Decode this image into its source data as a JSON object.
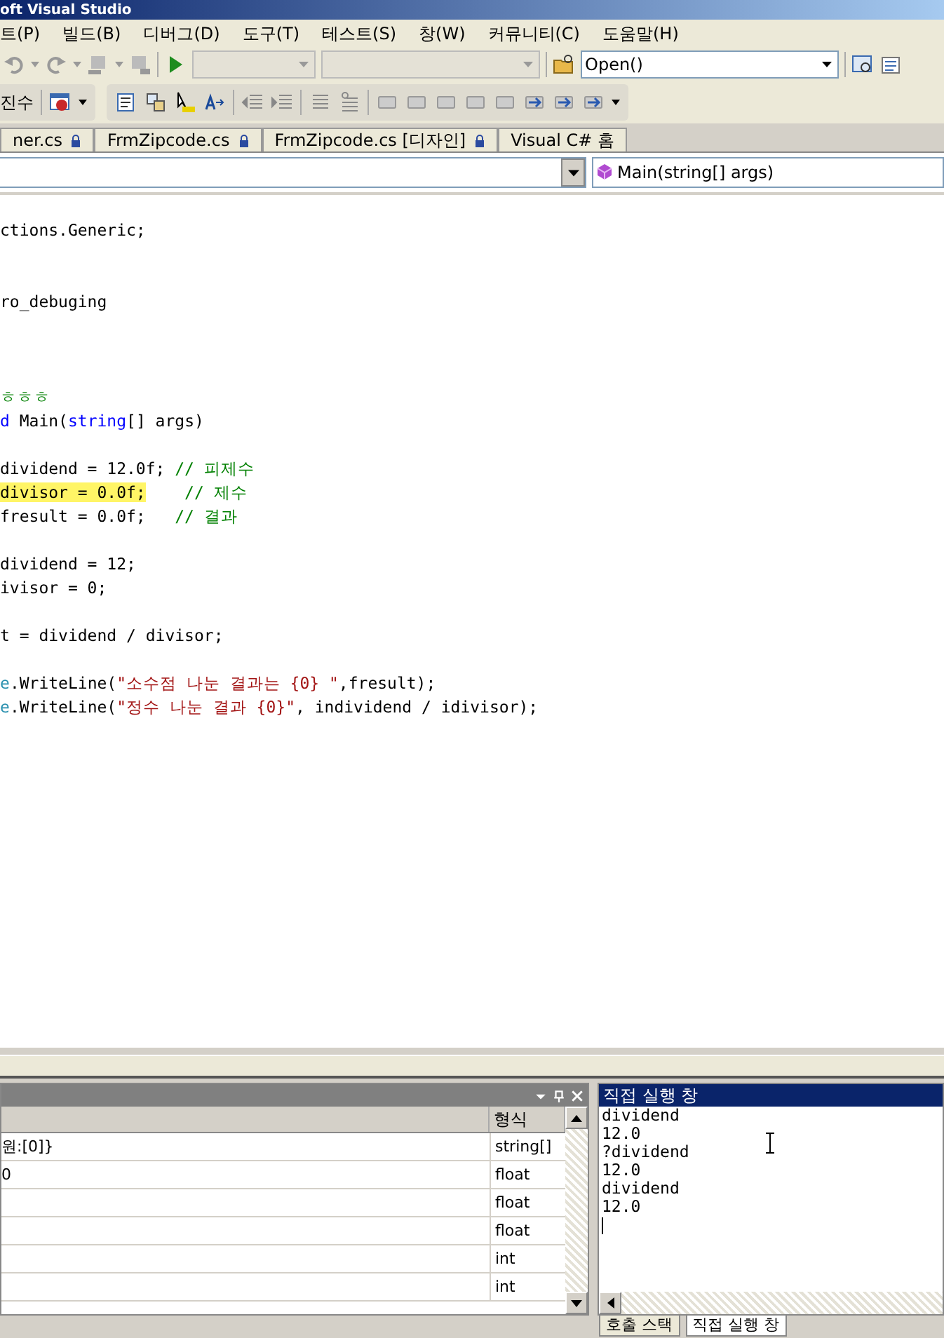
{
  "window": {
    "title": "oft Visual Studio"
  },
  "menu": [
    "트(P)",
    "빌드(B)",
    "디버그(D)",
    "도구(T)",
    "테스트(S)",
    "창(W)",
    "커뮤니티(C)",
    "도움말(H)"
  ],
  "toolbar": {
    "find_combo": {
      "value": "Open()"
    },
    "hex_button": "진수"
  },
  "doc_tabs": [
    {
      "label": "ner.cs",
      "locked": true,
      "selected": false
    },
    {
      "label": "FrmZipcode.cs",
      "locked": true,
      "selected": false
    },
    {
      "label": "FrmZipcode.cs [디자인]",
      "locked": true,
      "selected": false
    },
    {
      "label": "Visual C# 홈",
      "locked": false,
      "selected": false
    }
  ],
  "nav_bar": {
    "member": "Main(string[] args)"
  },
  "code_lines": [
    {
      "segments": [
        {
          "text": "ctions.Generic;",
          "kind": "plain"
        }
      ]
    },
    {
      "kind": "blank"
    },
    {
      "kind": "blank"
    },
    {
      "segments": [
        {
          "text": "ro_debuging",
          "kind": "plain"
        }
      ]
    },
    {
      "kind": "blank"
    },
    {
      "kind": "blank"
    },
    {
      "kind": "blank"
    },
    {
      "segments": [
        {
          "text": "ㅎㅎㅎ",
          "kind": "comment"
        }
      ]
    },
    {
      "segments": [
        {
          "text": "d ",
          "kind": "keyword"
        },
        {
          "text": "Main(",
          "kind": "plain"
        },
        {
          "text": "string",
          "kind": "keyword"
        },
        {
          "text": "[] args)",
          "kind": "plain"
        }
      ]
    },
    {
      "kind": "blank"
    },
    {
      "segments": [
        {
          "text": "dividend = 12.0f; ",
          "kind": "plain"
        },
        {
          "text": "// 피제수",
          "kind": "comment"
        }
      ]
    },
    {
      "segments": [
        {
          "text": "divisor = 0.0f;",
          "kind": "current"
        },
        {
          "text": "// 제수",
          "kind": "comment"
        }
      ]
    },
    {
      "segments": [
        {
          "text": "fresult = 0.0f;   ",
          "kind": "plain"
        },
        {
          "text": "// 결과",
          "kind": "comment"
        }
      ]
    },
    {
      "kind": "blank"
    },
    {
      "segments": [
        {
          "text": "dividend = 12;",
          "kind": "plain"
        }
      ]
    },
    {
      "segments": [
        {
          "text": "ivisor = 0;",
          "kind": "plain"
        }
      ]
    },
    {
      "kind": "blank"
    },
    {
      "segments": [
        {
          "text": "t = dividend / divisor;",
          "kind": "plain"
        }
      ]
    },
    {
      "kind": "blank"
    },
    {
      "segments": [
        {
          "text": "e",
          "kind": "type"
        },
        {
          "text": ".WriteLine(",
          "kind": "plain"
        },
        {
          "text": "\"소수점 나눈 결과는 {0} \"",
          "kind": "string"
        },
        {
          "text": ",fresult);",
          "kind": "plain"
        }
      ]
    },
    {
      "segments": [
        {
          "text": "e",
          "kind": "type"
        },
        {
          "text": ".WriteLine(",
          "kind": "plain"
        },
        {
          "text": "\"정수 나눈 결과 {0}\"",
          "kind": "string"
        },
        {
          "text": ", individend / idivisor);",
          "kind": "plain"
        }
      ]
    }
  ],
  "locals": {
    "type_header": "형식",
    "rows": [
      {
        "value": "원:[0]}",
        "type": "string[]"
      },
      {
        "value": "0",
        "type": "float"
      },
      {
        "type": "float"
      },
      {
        "type": "float"
      },
      {
        "type": "int"
      },
      {
        "type": "int"
      }
    ]
  },
  "immediate": {
    "title": "직접 실행 창",
    "lines": [
      "dividend",
      "12.0",
      "?dividend",
      "12.0",
      "dividend",
      "12.0"
    ]
  },
  "bottom_tabs": [
    {
      "label": "호출 스택",
      "selected": false
    },
    {
      "label": "직접 실행 창",
      "selected": true
    }
  ]
}
